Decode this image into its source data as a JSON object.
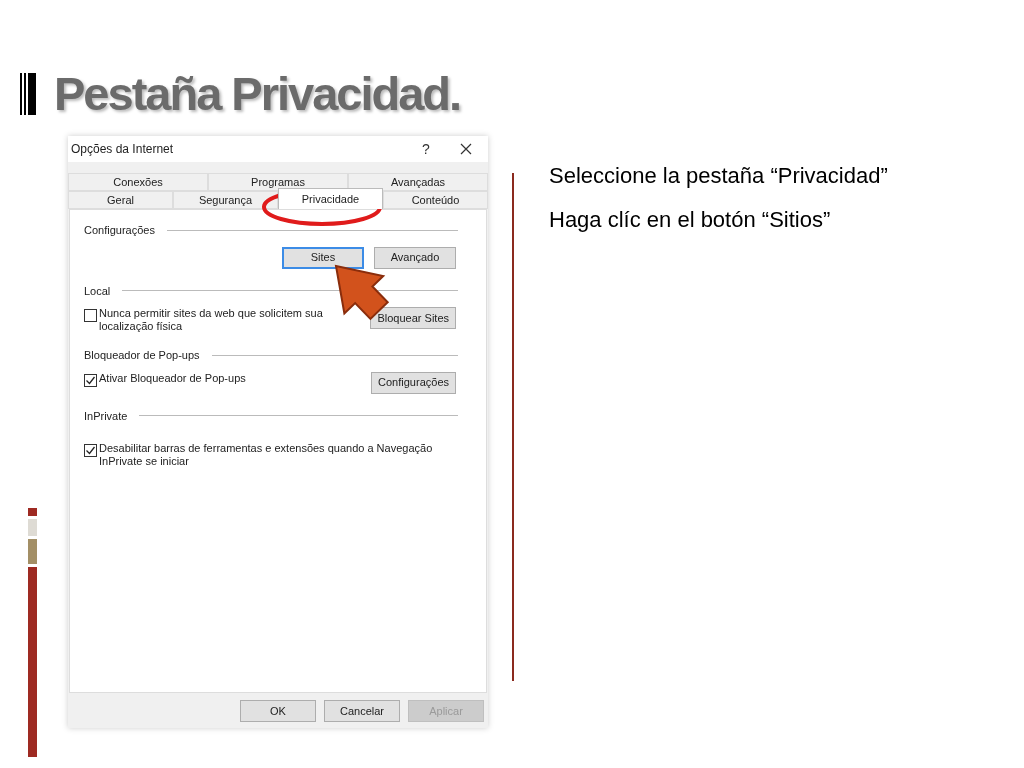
{
  "title": "Pestaña Privacidad.",
  "dialog": {
    "title": "Opções da Internet",
    "help": "?",
    "tab_rows": [
      [
        {
          "label": "Conexões",
          "selected": false
        },
        {
          "label": "Programas",
          "selected": false
        },
        {
          "label": "Avançadas",
          "selected": false
        }
      ],
      [
        {
          "label": "Geral",
          "selected": false
        },
        {
          "label": "Segurança",
          "selected": false
        },
        {
          "label": "Privacidade",
          "selected": true
        },
        {
          "label": "Conteúdo",
          "selected": false
        }
      ]
    ],
    "sections": [
      {
        "heading": "Configurações",
        "buttons": [
          {
            "label": "Sites",
            "focused": true
          },
          {
            "label": "Avançado",
            "focused": false
          }
        ]
      },
      {
        "heading": "Local",
        "checkbox": {
          "label": "Nunca permitir sites da web que solicitem sua localização física",
          "checked": false
        },
        "buttons": [
          {
            "label": "Bloquear Sites",
            "focused": false
          }
        ]
      },
      {
        "heading": "Bloqueador de Pop-ups",
        "checkbox": {
          "label": "Ativar Bloqueador de Pop-ups",
          "checked": true
        },
        "buttons": [
          {
            "label": "Configurações",
            "focused": false
          }
        ]
      },
      {
        "heading": "InPrivate",
        "checkbox": {
          "label": "Desabilitar barras de ferramentas e extensões quando a Navegação InPrivate se iniciar",
          "checked": true
        }
      }
    ],
    "footer_buttons": [
      {
        "label": "OK",
        "disabled": false
      },
      {
        "label": "Cancelar",
        "disabled": false
      },
      {
        "label": "Aplicar",
        "disabled": true
      }
    ]
  },
  "notes": [
    "Seleccione la pestaña  “Privacidad”",
    "Haga clíc en el botón “Sitios”"
  ]
}
